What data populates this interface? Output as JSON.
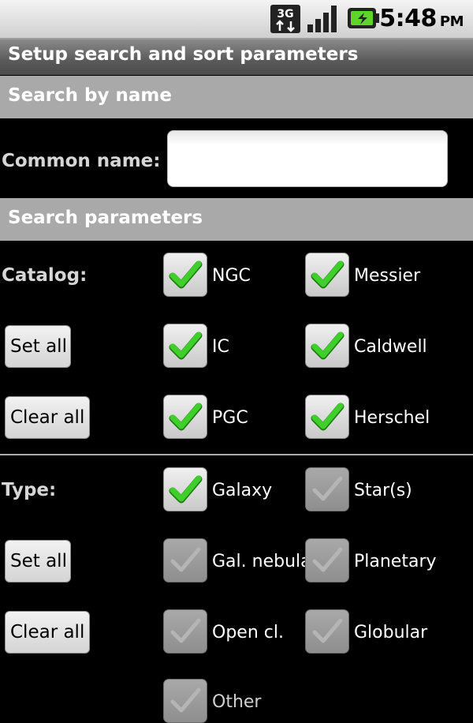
{
  "status_bar": {
    "network_label": "3G",
    "time": "5:48",
    "ampm": "PM",
    "icons": [
      "3g-icon",
      "signal-icon",
      "battery-charging-icon"
    ]
  },
  "title": "Setup search and sort parameters",
  "sections": {
    "search_by_name": "Search by name",
    "search_parameters": "Search parameters"
  },
  "common_name": {
    "label": "Common name:",
    "value": "",
    "placeholder": ""
  },
  "catalog": {
    "label": "Catalog:",
    "set_all": "Set all",
    "clear_all": "Clear all",
    "options": [
      {
        "label": "NGC",
        "checked": true
      },
      {
        "label": "Messier",
        "checked": true
      },
      {
        "label": "IC",
        "checked": true
      },
      {
        "label": "Caldwell",
        "checked": true
      },
      {
        "label": "PGC",
        "checked": true
      },
      {
        "label": "Herschel",
        "checked": true
      }
    ]
  },
  "type": {
    "label": "Type:",
    "set_all": "Set all",
    "clear_all": "Clear all",
    "options": [
      {
        "label": "Galaxy",
        "checked": true
      },
      {
        "label": "Star(s)",
        "checked": false
      },
      {
        "label": "Gal. nebula",
        "checked": false
      },
      {
        "label": "Planetary",
        "checked": false
      },
      {
        "label": "Open cl.",
        "checked": false
      },
      {
        "label": "Globular",
        "checked": false
      },
      {
        "label": "Other",
        "checked": false
      }
    ]
  },
  "colors": {
    "check_on": "#3fcf2a",
    "check_off": "#b5b5b5",
    "section_bg": "#a9a9a9"
  }
}
